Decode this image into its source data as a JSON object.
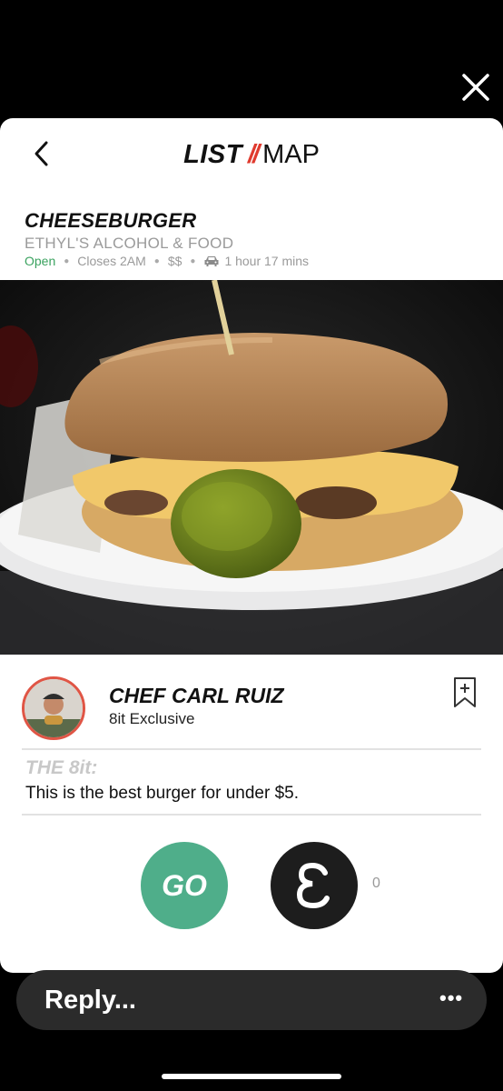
{
  "nav": {
    "list_label": "LIST",
    "separator": "//",
    "map_label": "MAP"
  },
  "dish": {
    "name": "CHEESEBURGER",
    "restaurant": "ETHYL'S ALCOHOL & FOOD",
    "status": "Open",
    "closes": "Closes 2AM",
    "price": "$$",
    "drive_time": "1 hour 17 mins"
  },
  "chef": {
    "name": "CHEF CARL RUIZ",
    "subtitle": "8it Exclusive"
  },
  "review": {
    "heading": "THE 8it:",
    "text": "This is the best burger for under $5."
  },
  "actions": {
    "go_label": "GO",
    "eight_count": "0"
  },
  "reply": {
    "placeholder": "Reply...",
    "more": "•••"
  },
  "colors": {
    "accent_red": "#e03a2e",
    "go_green": "#4fae8a",
    "open_green": "#3aa25f"
  },
  "icons": [
    "close-icon",
    "back-chevron-icon",
    "car-icon",
    "bookmark-add-icon",
    "eight-logo-icon"
  ]
}
